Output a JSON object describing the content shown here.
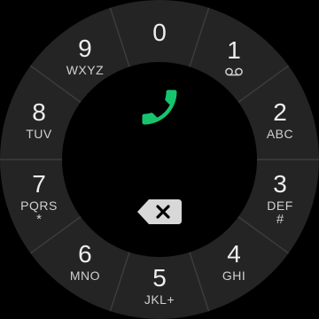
{
  "dialer": {
    "keys": [
      {
        "digit": "0",
        "letters": "",
        "sub": ""
      },
      {
        "digit": "1",
        "letters": "",
        "sub": "voicemail-icon"
      },
      {
        "digit": "2",
        "letters": "ABC",
        "sub": ""
      },
      {
        "digit": "3",
        "letters": "DEF",
        "sub": "#"
      },
      {
        "digit": "4",
        "letters": "GHI",
        "sub": ""
      },
      {
        "digit": "5",
        "letters": "JKL+",
        "sub": ""
      },
      {
        "digit": "6",
        "letters": "MNO",
        "sub": ""
      },
      {
        "digit": "7",
        "letters": "PQRS",
        "sub": "*"
      },
      {
        "digit": "8",
        "letters": "TUV",
        "sub": ""
      },
      {
        "digit": "9",
        "letters": "WXYZ",
        "sub": ""
      }
    ],
    "call_icon": "phone-icon",
    "backspace_icon": "backspace-icon",
    "colors": {
      "background": "#000000",
      "ring": "#242424",
      "separator": "#3c3c3c",
      "call_green": "#16c46e",
      "text": "#e8e8e8",
      "backspace": "#d8d8d8"
    }
  }
}
